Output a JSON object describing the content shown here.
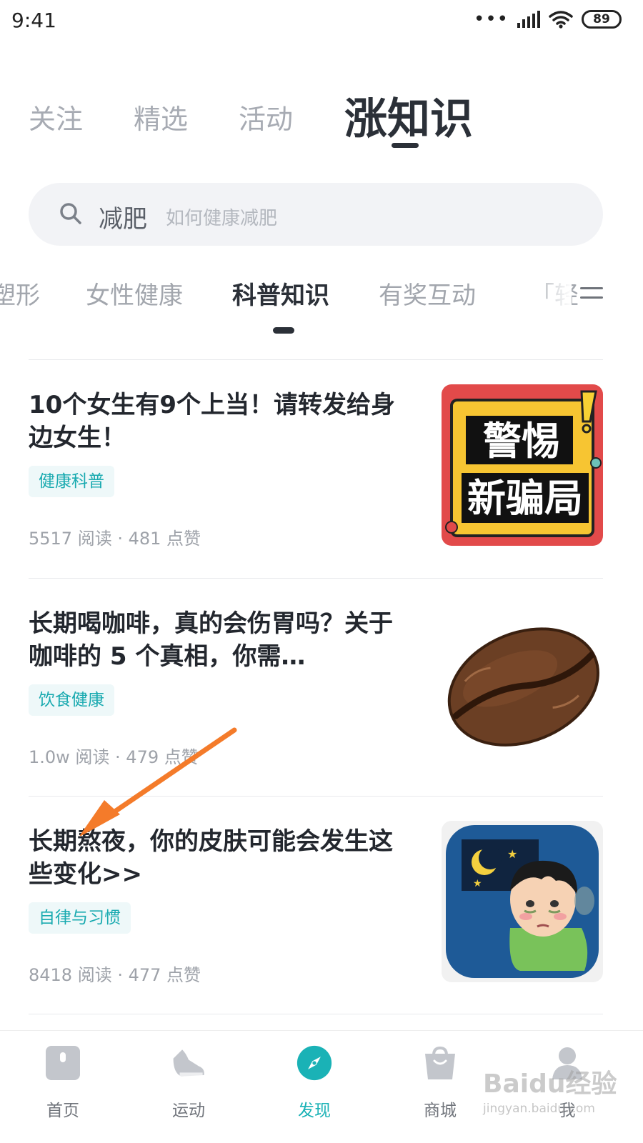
{
  "status": {
    "time": "9:41",
    "battery": "89"
  },
  "top_tabs": [
    {
      "label": "关注"
    },
    {
      "label": "精选"
    },
    {
      "label": "活动"
    },
    {
      "label": "涨知识",
      "active": true
    }
  ],
  "search": {
    "keyword": "减肥",
    "hint": "如何健康减肥"
  },
  "sub_tabs": [
    {
      "label": "塑形"
    },
    {
      "label": "女性健康"
    },
    {
      "label": "科普知识",
      "active": true
    },
    {
      "label": "有奖互动"
    },
    {
      "label": "「轻"
    }
  ],
  "articles": [
    {
      "title": "10个女生有9个上当！请转发给身边女生！",
      "tag": "健康科普",
      "meta": "5517 阅读 · 481 点赞",
      "thumb_text_1": "警惕",
      "thumb_text_2": "新骗局",
      "thumb_mark": "!"
    },
    {
      "title": "长期喝咖啡，真的会伤胃吗？关于咖啡的 5 个真相，你需…",
      "tag": "饮食健康",
      "meta": "1.0w 阅读 · 479 点赞"
    },
    {
      "title": "长期熬夜，你的皮肤可能会发生这些变化>>",
      "tag": "自律与习惯",
      "meta": "8418 阅读 · 477 点赞"
    }
  ],
  "bottom_nav": [
    {
      "label": "首页",
      "icon": "home-icon"
    },
    {
      "label": "运动",
      "icon": "shoe-icon"
    },
    {
      "label": "发现",
      "icon": "compass-icon",
      "active": true
    },
    {
      "label": "商城",
      "icon": "shopping-bag-icon"
    },
    {
      "label": "我",
      "icon": "person-icon"
    }
  ],
  "watermark": {
    "text": "Baidu经验",
    "url": "jingyan.baidu.com"
  },
  "colors": {
    "accent": "#1ab2b6",
    "tag_bg": "#eef8f9",
    "arrow": "#f47b2a",
    "text_dark": "#23272e",
    "text_muted": "#9ea2a9"
  }
}
